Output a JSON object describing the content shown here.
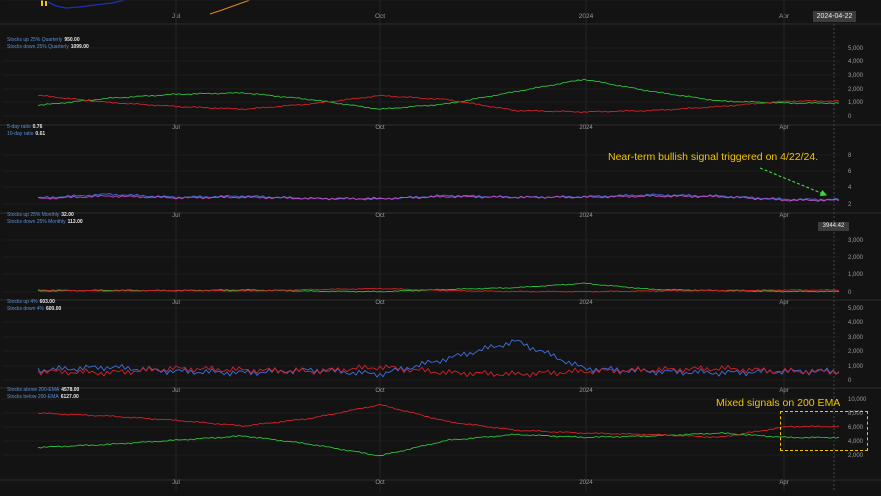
{
  "top": {
    "date_label": "2024-04-22"
  },
  "colors": {
    "bg": "#131313",
    "grid": "#262626",
    "axis_text": "#9a9a9a",
    "legend_label": "#5a8fd6",
    "green": "#2fbf3a",
    "red": "#d2222a",
    "blue": "#3d6fe0",
    "pink": "#c548c5",
    "annotation": "#f2c500"
  },
  "panes": [
    {
      "legend": [
        {
          "label": "Stocks up 25% Quarterly",
          "value": "950.00"
        },
        {
          "label": "Stocks down 25% Quarterly",
          "value": "1099.00"
        }
      ],
      "axis_ticks": [
        "5,000",
        "4,000",
        "3,000",
        "2,000",
        "1,000",
        "0"
      ],
      "x_labels": [
        "Jul",
        "Oct",
        "2024",
        "Apr"
      ]
    },
    {
      "legend": [
        {
          "label": "5-day ratio",
          "value": "0.76"
        },
        {
          "label": "10-day ratio",
          "value": "0.61"
        }
      ],
      "axis_ticks": [
        "8",
        "6",
        "4",
        "2",
        "0"
      ],
      "x_labels": [
        "Jul",
        "Oct",
        "2024",
        "Apr"
      ],
      "annotation": "Near-term bullish signal triggered on 4/22/24."
    },
    {
      "legend": [
        {
          "label": "Stocks up 25% Monthly",
          "value": "32.00"
        },
        {
          "label": "Stocks down 25% Monthly",
          "value": "113.00"
        }
      ],
      "axis_ticks": [
        "3,000",
        "2,000",
        "1,000",
        "0"
      ],
      "x_labels": [
        "Jul",
        "Oct",
        "2024",
        "Apr"
      ],
      "price_flag": "3944.42"
    },
    {
      "legend": [
        {
          "label": "Stocks up 4%",
          "value": "603.00"
        },
        {
          "label": "Stocks down 4%",
          "value": "600.00"
        }
      ],
      "axis_ticks": [
        "5,000",
        "4,000",
        "3,000",
        "2,000",
        "1,000",
        "0"
      ],
      "x_labels": [
        "Jul",
        "Oct",
        "2024",
        "Apr"
      ]
    },
    {
      "legend": [
        {
          "label": "Stocks above 200-EMA",
          "value": "4578.00"
        },
        {
          "label": "Stocks below 200-EMA",
          "value": "6127.00"
        }
      ],
      "axis_ticks": [
        "10,000",
        "8,000",
        "6,000",
        "4,000",
        "2,000"
      ],
      "x_labels": [
        "Jul",
        "Oct",
        "2024",
        "Apr"
      ],
      "annotation": "Mixed signals on 200 EMA"
    }
  ],
  "chart_data": [
    {
      "type": "line",
      "x": [
        "2023-05",
        "2023-06",
        "2023-07",
        "2023-08",
        "2023-09",
        "2023-10",
        "2023-11",
        "2023-12",
        "2024-01",
        "2024-02",
        "2024-03",
        "2024-04"
      ],
      "series": [
        {
          "name": "Stocks up 25% Quarterly",
          "color": "#2fbf3a",
          "values": [
            800,
            1300,
            1600,
            1700,
            1200,
            500,
            900,
            1800,
            2700,
            1800,
            1100,
            950
          ]
        },
        {
          "name": "Stocks down 25% Quarterly",
          "color": "#d2222a",
          "values": [
            1500,
            1000,
            700,
            500,
            900,
            1500,
            1200,
            400,
            300,
            400,
            700,
            1099
          ]
        }
      ],
      "ylim": [
        0,
        5000
      ]
    },
    {
      "type": "line",
      "x": [
        "2023-05",
        "2023-06",
        "2023-07",
        "2023-08",
        "2023-09",
        "2023-10",
        "2023-11",
        "2023-12",
        "2024-01",
        "2024-02",
        "2024-03",
        "2024-04"
      ],
      "series": [
        {
          "name": "5-day ratio",
          "color": "#3d6fe0",
          "values": [
            1.0,
            1.6,
            1.1,
            1.3,
            0.9,
            0.8,
            1.4,
            1.1,
            1.2,
            1.5,
            1.3,
            0.76
          ]
        },
        {
          "name": "10-day ratio",
          "color": "#c548c5",
          "values": [
            0.9,
            1.3,
            1.0,
            1.1,
            0.9,
            0.9,
            1.2,
            1.1,
            1.1,
            1.3,
            1.2,
            0.61
          ]
        }
      ],
      "ylim": [
        0,
        8
      ]
    },
    {
      "type": "line",
      "x": [
        "2023-05",
        "2023-06",
        "2023-07",
        "2023-08",
        "2023-09",
        "2023-10",
        "2023-11",
        "2023-12",
        "2024-01",
        "2024-02",
        "2024-03",
        "2024-04"
      ],
      "series": [
        {
          "name": "Stocks up 25% Monthly",
          "color": "#2fbf3a",
          "values": [
            60,
            100,
            80,
            120,
            50,
            20,
            150,
            250,
            500,
            150,
            80,
            32
          ]
        },
        {
          "name": "Stocks down 25% Monthly",
          "color": "#d2222a",
          "values": [
            120,
            60,
            90,
            60,
            140,
            200,
            80,
            30,
            20,
            60,
            90,
            113
          ]
        }
      ],
      "ylim": [
        0,
        3000
      ]
    },
    {
      "type": "line",
      "x": [
        "2023-05",
        "2023-06",
        "2023-07",
        "2023-08",
        "2023-09",
        "2023-10",
        "2023-11",
        "2023-12",
        "2024-01",
        "2024-02",
        "2024-03",
        "2024-04"
      ],
      "series": [
        {
          "name": "Stocks up 4%",
          "color": "#3d6fe0",
          "values": [
            700,
            900,
            600,
            500,
            700,
            400,
            1500,
            2700,
            800,
            600,
            500,
            603
          ]
        },
        {
          "name": "Stocks down 4%",
          "color": "#d2222a",
          "values": [
            600,
            500,
            800,
            700,
            600,
            900,
            500,
            400,
            600,
            700,
            800,
            600
          ]
        }
      ],
      "ylim": [
        0,
        5000
      ]
    },
    {
      "type": "line",
      "x": [
        "2023-05",
        "2023-06",
        "2023-07",
        "2023-08",
        "2023-09",
        "2023-10",
        "2023-11",
        "2023-12",
        "2024-01",
        "2024-02",
        "2024-03",
        "2024-04"
      ],
      "series": [
        {
          "name": "Stocks above 200-EMA",
          "color": "#2fbf3a",
          "values": [
            3200,
            3600,
            4200,
            4800,
            3600,
            2000,
            4200,
            5000,
            4600,
            4800,
            5200,
            4578
          ]
        },
        {
          "name": "Stocks below 200-EMA",
          "color": "#d2222a",
          "values": [
            8000,
            7600,
            7000,
            6200,
            7300,
            9200,
            6800,
            5600,
            5200,
            5000,
            4600,
            6127
          ]
        }
      ],
      "ylim": [
        0,
        10000
      ]
    }
  ]
}
